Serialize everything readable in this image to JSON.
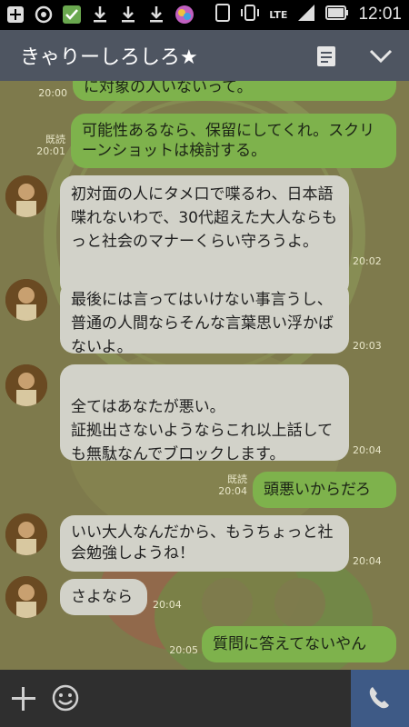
{
  "status": {
    "time": "12:01",
    "network": "LTE"
  },
  "header": {
    "title": "きゃりーしろしろ★"
  },
  "messages": [
    {
      "dir": "out",
      "text": "に対象の人いないって。",
      "time": "20:00"
    },
    {
      "dir": "out",
      "text": "可能性あるなら、保留にしてくれ。スクリーンショットは検討する。",
      "read": "既読",
      "time": "20:01"
    },
    {
      "dir": "in",
      "text": "初対面の人にタメ口で喋るわ、日本語喋れないわで、30代超えた大人ならもっと社会のマナーくらい守ろうよ。",
      "time": "20:02"
    },
    {
      "dir": "in",
      "text": "最後には言ってはいけない事言うし、普通の人間ならそんな言葉思い浮かばないよ。",
      "time": "20:03"
    },
    {
      "dir": "in",
      "text": "全てはあなたが悪い。\n証拠出さないようならこれ以上話しても無駄なんでブロックします。",
      "time": "20:04"
    },
    {
      "dir": "out",
      "text": "頭悪いからだろ",
      "read": "既読",
      "time": "20:04"
    },
    {
      "dir": "in",
      "text": "いい大人なんだから、もうちょっと社会勉強しようね！",
      "time": "20:04"
    },
    {
      "dir": "in",
      "text": "さよなら",
      "time": "20:04"
    },
    {
      "dir": "out",
      "text": "質問に答えてないやん",
      "time": "20:05"
    }
  ]
}
